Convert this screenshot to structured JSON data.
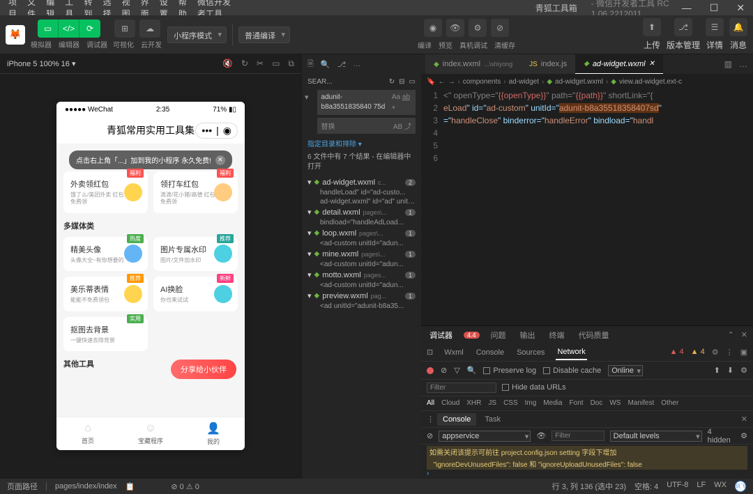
{
  "titlebar": {
    "title": "青狐工具箱",
    "subtitle": "- 微信开发者工具 RC 1.06.2212011"
  },
  "menu": [
    "项目",
    "文件",
    "编辑",
    "工具",
    "转到",
    "选择",
    "视图",
    "界面",
    "设置",
    "帮助",
    "微信开发者工具"
  ],
  "toolbar": {
    "mode_labels": [
      "模拟器",
      "编辑器",
      "调试器"
    ],
    "extra_labels": [
      "可视化",
      "云开发"
    ],
    "select1": "小程序模式",
    "select2": "普通编译",
    "center_labels": [
      "编译",
      "预览",
      "真机调试",
      "清缓存"
    ],
    "right_labels": [
      "上传",
      "版本管理",
      "详情",
      "消息"
    ]
  },
  "sim": {
    "device": "iPhone 5 100% 16 ▾",
    "phone": {
      "carrier": "●●●●● WeChat",
      "time": "2:35",
      "battery": "71% ▮▯",
      "nav_title": "青狐常用实用工具集",
      "toast": "点击右上角「...」加到我的小程序 永久免费!",
      "section1": [
        {
          "t": "外卖领红包",
          "s": "饿了么/美团外卖 红包 天天免费领",
          "badge": "福利"
        },
        {
          "t": "领打车红包",
          "s": "滴滴/花小猪/高德 红包 天天免费领",
          "badge": "福利"
        }
      ],
      "sec2_title": "多媒体类",
      "section2": [
        {
          "t": "精美头像",
          "s": "头像大全~有你想要的",
          "badge": "热度"
        },
        {
          "t": "图片专属水印",
          "s": "图片/文件加水印",
          "badge": "推荐"
        },
        {
          "t": "美乐蒂表情",
          "s": "能能不免费领包",
          "badge": "推荐"
        },
        {
          "t": "AI换脸",
          "s": "你也来试试",
          "badge": "新鲜"
        },
        {
          "t": "抠图去背景",
          "s": "一键快速去除背景",
          "badge": "实用"
        }
      ],
      "sec3_title": "其他工具",
      "share": "分享给小伙伴",
      "tabs": [
        "首页",
        "宝藏程序",
        "我的"
      ]
    }
  },
  "search": {
    "label": "SEAR...",
    "query": "adunit-b8a3551835840 75d",
    "replace": "替换",
    "opt": "指定目录和排除 ▾",
    "status": "6 文件中有 7 个结果 - 在编辑器中打开",
    "files": [
      {
        "name": "ad-widget.wxml",
        "path": "c...",
        "count": "2",
        "matches": [
          "handleLoad\" id=\"ad-custo...",
          "ad-widget.wxml\" id=\"ad\" unitI..."
        ]
      },
      {
        "name": "detail.wxml",
        "path": "pages\\...",
        "count": "1",
        "matches": [
          "bindload=\"handleAdLoad..."
        ]
      },
      {
        "name": "loop.wxml",
        "path": "pages\\...",
        "count": "1",
        "matches": [
          "<ad-custom unitId=\"adun..."
        ]
      },
      {
        "name": "mine.wxml",
        "path": "pages\\...",
        "count": "1",
        "matches": [
          "<ad-custom unitId=\"adun..."
        ]
      },
      {
        "name": "motto.wxml",
        "path": "pages...",
        "count": "1",
        "matches": [
          "<ad-custom unitId=\"adun..."
        ]
      },
      {
        "name": "preview.wxml",
        "path": "pag...",
        "count": "1",
        "matches": [
          "<ad unitId=\"adunit-b8a35..."
        ]
      }
    ]
  },
  "editor": {
    "tabs": [
      {
        "name": "index.wxml",
        "path": "...\\shiyong"
      },
      {
        "name": "index.js",
        "path": ""
      },
      {
        "name": "ad-widget.wxml",
        "path": "",
        "active": true
      }
    ],
    "crumbs": [
      "components",
      "ad-widget",
      "ad-widget.wxml",
      "view.ad-widget.ext-c"
    ],
    "code": {
      "l1a": "<\" openType=\"",
      "l1b": "{{openType}}",
      "l1c": "\" path=\"",
      "l1d": "{{path}}",
      "l1e": "\" shortLink=\"{",
      "l2a": "eLoad",
      "l2b": "\" id=\"",
      "l2c": "ad-custom",
      "l2d": "\" unitId=\"",
      "l2e": "adunit-b8a35518358407sd",
      "l2f": "\"",
      "l3a": "=\"",
      "l3b": "handleClose",
      "l3c": "\" binderror=\"",
      "l3d": "handleError",
      "l3e": "\" bindload=\"",
      "l3f": "handl"
    }
  },
  "devtools": {
    "tabs": [
      "调试器",
      "问题",
      "输出",
      "终端",
      "代码质量"
    ],
    "badge": "4.4",
    "nettabs": [
      "Wxml",
      "Console",
      "Sources",
      "Network"
    ],
    "warn": "▲ 4",
    "err": "▲ 4",
    "tb": {
      "preserve": "Preserve log",
      "disable": "Disable cache",
      "online": "Online"
    },
    "filter_placeholder": "Filter",
    "hide_urls": "Hide data URLs",
    "types": [
      "Cloud",
      "XHR",
      "JS",
      "CSS",
      "Img",
      "Media",
      "Font",
      "Doc",
      "WS",
      "Manifest",
      "Other"
    ],
    "console_tabs": [
      "Console",
      "Task"
    ],
    "context": "appservice",
    "levels": "Default levels",
    "hidden": "4 hidden",
    "warn_line": "\"ignoreDevUnusedFiles\": false 和 \"ignoreUploadUnusedFiles\": false",
    "warn_pre": "如需关闭该提示可前往 project.config.json setting 字段下增加"
  },
  "statusbar": {
    "left1": "页面路径",
    "left2": "pages/index/index",
    "mid": "⊘ 0 ⚠ 0",
    "right": [
      "行 3, 列 136 (选中 23)",
      "空格: 4",
      "UTF-8",
      "LF",
      "WX"
    ]
  }
}
